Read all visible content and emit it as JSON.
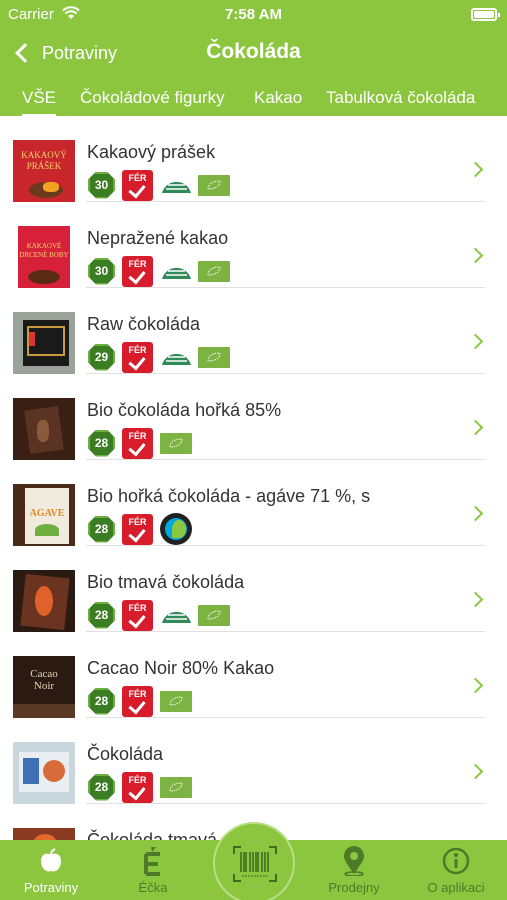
{
  "status_bar": {
    "carrier": "Carrier",
    "time": "7:58 AM"
  },
  "nav": {
    "back_label": "Potraviny",
    "title": "Čokoláda"
  },
  "tabs": [
    {
      "label": "VŠE",
      "active": true
    },
    {
      "label": "Čokoládové figurky",
      "active": false
    },
    {
      "label": "Kakao",
      "active": false
    },
    {
      "label": "Tabulková čokoláda",
      "active": false
    }
  ],
  "products": [
    {
      "name": "Kakaový prášek",
      "score": "30",
      "thumb_text": [
        "KAKAOVÝ",
        "PRÁŠEK"
      ],
      "badges": [
        "fer",
        "demeter",
        "eu-organic"
      ]
    },
    {
      "name": "Nepražené kakao",
      "score": "30",
      "thumb_text": [
        "KAKAOVÉ",
        "DRCENÉ BOBY"
      ],
      "badges": [
        "fer",
        "demeter",
        "eu-organic"
      ]
    },
    {
      "name": "Raw čokoláda",
      "score": "29",
      "badges": [
        "fer",
        "demeter",
        "eu-organic"
      ]
    },
    {
      "name": "Bio čokoláda hořká 85%",
      "score": "28",
      "badges": [
        "fer",
        "eu-organic"
      ]
    },
    {
      "name": "Bio hořká čokoláda - agáve 71 %, s",
      "score": "28",
      "thumb_text": [
        "AGAVE"
      ],
      "badges": [
        "fer",
        "fairtrade"
      ]
    },
    {
      "name": "Bio tmavá čokoláda",
      "score": "28",
      "badges": [
        "fer",
        "demeter",
        "eu-organic"
      ]
    },
    {
      "name": "Cacao Noir 80% Kakao",
      "score": "28",
      "thumb_text": [
        "Cacao",
        "Noir"
      ],
      "badges": [
        "fer",
        "eu-organic"
      ]
    },
    {
      "name": "Čokoláda",
      "score": "28",
      "badges": [
        "fer",
        "eu-organic"
      ]
    },
    {
      "name": "Čokoláda tmavá s ...li",
      "score": "",
      "badges": []
    }
  ],
  "badge_text": {
    "fer": "FÉR"
  },
  "tabbar": {
    "items": [
      {
        "label": "Potraviny",
        "icon": "apple-icon",
        "active": true
      },
      {
        "label": "Éčka",
        "icon": "e-letter-icon",
        "active": false
      },
      {
        "label": "Prodejny",
        "icon": "map-pin-icon",
        "active": false
      },
      {
        "label": "O aplikaci",
        "icon": "info-icon",
        "active": false
      }
    ],
    "scan_icon": "barcode-icon"
  },
  "colors": {
    "brand_green": "#8cc63f",
    "score_green": "#3b7d23",
    "fer_red": "#d71d2b",
    "inactive_tab": "#4c7a28"
  }
}
